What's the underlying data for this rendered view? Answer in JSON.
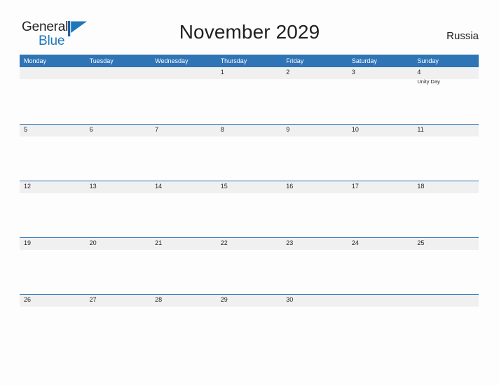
{
  "brand": {
    "name_part1": "General",
    "name_part2": "Blue",
    "flag_icon": "blue-flag-triangle",
    "accent_color": "#1f76bc"
  },
  "header": {
    "title": "November 2029",
    "country": "Russia"
  },
  "theme": {
    "header_blue": "#2f74b5",
    "band_gray": "#f0f0f0",
    "page_background": "#fdfdfd",
    "text_color": "#231f20"
  },
  "calendar": {
    "month": "November",
    "year": "2029",
    "weekday_headers": [
      "Monday",
      "Tuesday",
      "Wednesday",
      "Thursday",
      "Friday",
      "Saturday",
      "Sunday"
    ],
    "weeks": [
      [
        {
          "day": "",
          "event": ""
        },
        {
          "day": "",
          "event": ""
        },
        {
          "day": "",
          "event": ""
        },
        {
          "day": "1",
          "event": ""
        },
        {
          "day": "2",
          "event": ""
        },
        {
          "day": "3",
          "event": ""
        },
        {
          "day": "4",
          "event": "Unity Day"
        }
      ],
      [
        {
          "day": "5",
          "event": ""
        },
        {
          "day": "6",
          "event": ""
        },
        {
          "day": "7",
          "event": ""
        },
        {
          "day": "8",
          "event": ""
        },
        {
          "day": "9",
          "event": ""
        },
        {
          "day": "10",
          "event": ""
        },
        {
          "day": "11",
          "event": ""
        }
      ],
      [
        {
          "day": "12",
          "event": ""
        },
        {
          "day": "13",
          "event": ""
        },
        {
          "day": "14",
          "event": ""
        },
        {
          "day": "15",
          "event": ""
        },
        {
          "day": "16",
          "event": ""
        },
        {
          "day": "17",
          "event": ""
        },
        {
          "day": "18",
          "event": ""
        }
      ],
      [
        {
          "day": "19",
          "event": ""
        },
        {
          "day": "20",
          "event": ""
        },
        {
          "day": "21",
          "event": ""
        },
        {
          "day": "22",
          "event": ""
        },
        {
          "day": "23",
          "event": ""
        },
        {
          "day": "24",
          "event": ""
        },
        {
          "day": "25",
          "event": ""
        }
      ],
      [
        {
          "day": "26",
          "event": ""
        },
        {
          "day": "27",
          "event": ""
        },
        {
          "day": "28",
          "event": ""
        },
        {
          "day": "29",
          "event": ""
        },
        {
          "day": "30",
          "event": ""
        },
        {
          "day": "",
          "event": ""
        },
        {
          "day": "",
          "event": ""
        }
      ]
    ]
  }
}
